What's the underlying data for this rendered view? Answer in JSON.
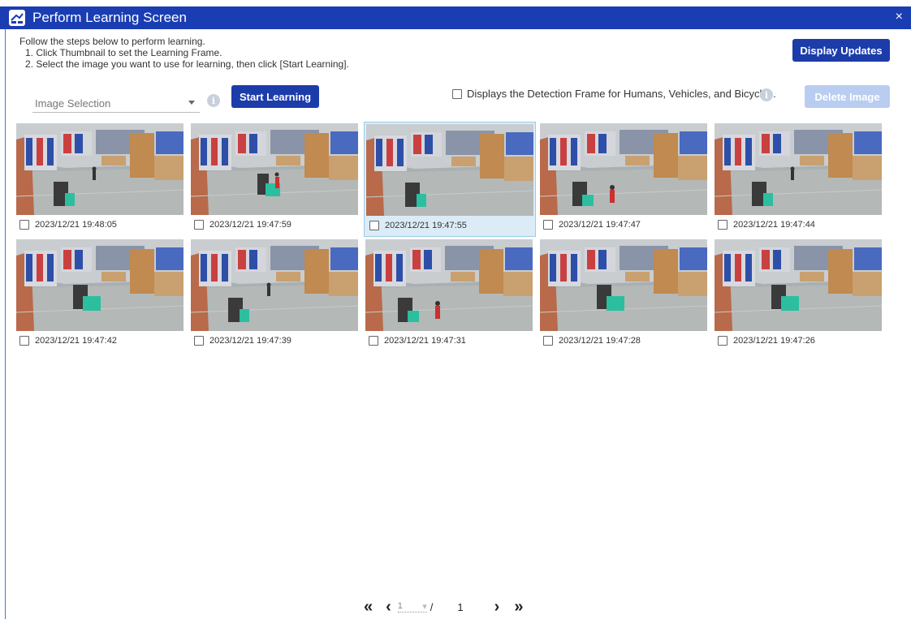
{
  "window": {
    "title": "Perform Learning Screen",
    "close_glyph": "×"
  },
  "instructions": {
    "line1": "Follow the steps below to perform learning.",
    "step1": "1. Click Thumbnail to set the Learning Frame.",
    "step2": "2. Select the image you want to use for learning, then click [Start Learning]."
  },
  "toolbar": {
    "display_updates_label": "Display Updates",
    "image_selection_placeholder": "Image Selection",
    "start_learning_label": "Start Learning",
    "detection_frame_label": "Displays the Detection Frame for Humans, Vehicles, and Bicycles.",
    "delete_image_label": "Delete Image",
    "info_glyph": "i"
  },
  "thumbnails": [
    {
      "timestamp": "2023/12/21 19:48:05",
      "selected": false,
      "scene": "person-center"
    },
    {
      "timestamp": "2023/12/21 19:47:59",
      "selected": false,
      "scene": "forklift-with-person"
    },
    {
      "timestamp": "2023/12/21 19:47:55",
      "selected": true,
      "scene": "empty-floor"
    },
    {
      "timestamp": "2023/12/21 19:47:47",
      "selected": false,
      "scene": "person-red-vest"
    },
    {
      "timestamp": "2023/12/21 19:47:44",
      "selected": false,
      "scene": "person-center"
    },
    {
      "timestamp": "2023/12/21 19:47:42",
      "selected": false,
      "scene": "forklift-moving"
    },
    {
      "timestamp": "2023/12/21 19:47:39",
      "selected": false,
      "scene": "person-center"
    },
    {
      "timestamp": "2023/12/21 19:47:31",
      "selected": false,
      "scene": "person-red-vest"
    },
    {
      "timestamp": "2023/12/21 19:47:28",
      "selected": false,
      "scene": "forklift-moving"
    },
    {
      "timestamp": "2023/12/21 19:47:26",
      "selected": false,
      "scene": "forklift-moving"
    }
  ],
  "pagination": {
    "first_glyph": "«",
    "prev_glyph": "‹",
    "current_page": "1",
    "separator": "/",
    "total_pages": "1",
    "next_glyph": "›",
    "last_glyph": "»"
  },
  "colors": {
    "title_bar": "#1a3db3",
    "primary_button": "#1c3caa",
    "disabled_button": "#b9cdf0",
    "selected_thumb_bg": "#dcecf7"
  }
}
